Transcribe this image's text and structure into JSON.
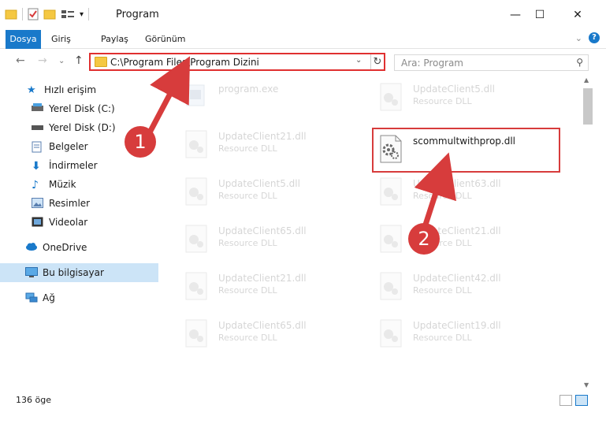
{
  "window": {
    "title": "Program",
    "minimize": "—",
    "maximize": "☐",
    "close": "✕"
  },
  "ribbon": {
    "tabs": [
      "Dosya",
      "Giriş",
      "Paylaş",
      "Görünüm"
    ],
    "help": "?"
  },
  "nav": {
    "back": "←",
    "forward": "→",
    "recent": "⌄",
    "up": "↑",
    "address": "C:\\Program Files\\Program Dizini",
    "search_placeholder": "Ara: Program"
  },
  "sidebar": {
    "items": [
      {
        "label": "Hızlı erişim",
        "icon": "star-icon"
      },
      {
        "label": "Yerel Disk (C:)",
        "icon": "drive-icon"
      },
      {
        "label": "Yerel Disk (D:)",
        "icon": "drive-icon"
      },
      {
        "label": "Belgeler",
        "icon": "documents-icon"
      },
      {
        "label": "İndirmeler",
        "icon": "download-icon"
      },
      {
        "label": "Müzik",
        "icon": "music-icon"
      },
      {
        "label": "Resimler",
        "icon": "pictures-icon"
      },
      {
        "label": "Videolar",
        "icon": "video-icon"
      },
      {
        "label": "OneDrive",
        "icon": "cloud-icon"
      },
      {
        "label": "Bu bilgisayar",
        "icon": "computer-icon"
      },
      {
        "label": "Ağ",
        "icon": "network-icon"
      }
    ]
  },
  "files": {
    "left": [
      {
        "name": "program.exe",
        "type": ""
      },
      {
        "name": "UpdateClient21.dll",
        "type": "Resource DLL"
      },
      {
        "name": "UpdateClient5.dll",
        "type": "Resource DLL"
      },
      {
        "name": "UpdateClient65.dll",
        "type": "Resource DLL"
      },
      {
        "name": "UpdateClient21.dll",
        "type": "Resource DLL"
      },
      {
        "name": "UpdateClient65.dll",
        "type": "Resource DLL"
      }
    ],
    "right": [
      {
        "name": "UpdateClient5.dll",
        "type": "Resource DLL"
      },
      {
        "name": "scommultwithprop.dll",
        "type": ""
      },
      {
        "name": "UpdateClient63.dll",
        "type": "Resource DLL"
      },
      {
        "name": "UpdateClient21.dll",
        "type": "Resource DLL"
      },
      {
        "name": "UpdateClient42.dll",
        "type": "Resource DLL"
      },
      {
        "name": "UpdateClient19.dll",
        "type": "Resource DLL"
      }
    ]
  },
  "status": {
    "count": "136 öge"
  },
  "annotations": {
    "step1": "1",
    "step2": "2",
    "color": "#d73c3c"
  }
}
